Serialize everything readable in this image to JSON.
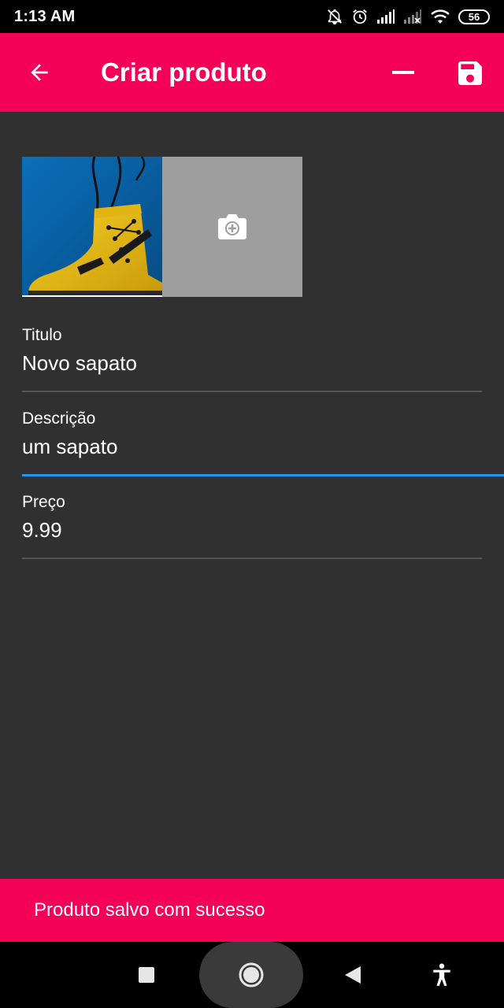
{
  "status_bar": {
    "time": "1:13 AM",
    "battery": "56"
  },
  "app_bar": {
    "title": "Criar produto",
    "back_icon": "arrow-back-icon",
    "remove_icon": "minus-icon",
    "save_icon": "save-icon"
  },
  "images": {
    "photo_description_icon": "boot-photo",
    "add_icon": "add-a-photo-icon"
  },
  "form": {
    "fields": [
      {
        "label": "Titulo",
        "value": "Novo sapato"
      },
      {
        "label": "Descrição",
        "value": "um sapato"
      },
      {
        "label": "Preço",
        "value": "9.99"
      }
    ]
  },
  "snackbar": {
    "message": "Produto salvo com sucesso"
  },
  "colors": {
    "accent": "#f50057",
    "background": "#303030",
    "focus_underline": "#2196f3",
    "add_photo_tile": "#9e9e9e"
  }
}
